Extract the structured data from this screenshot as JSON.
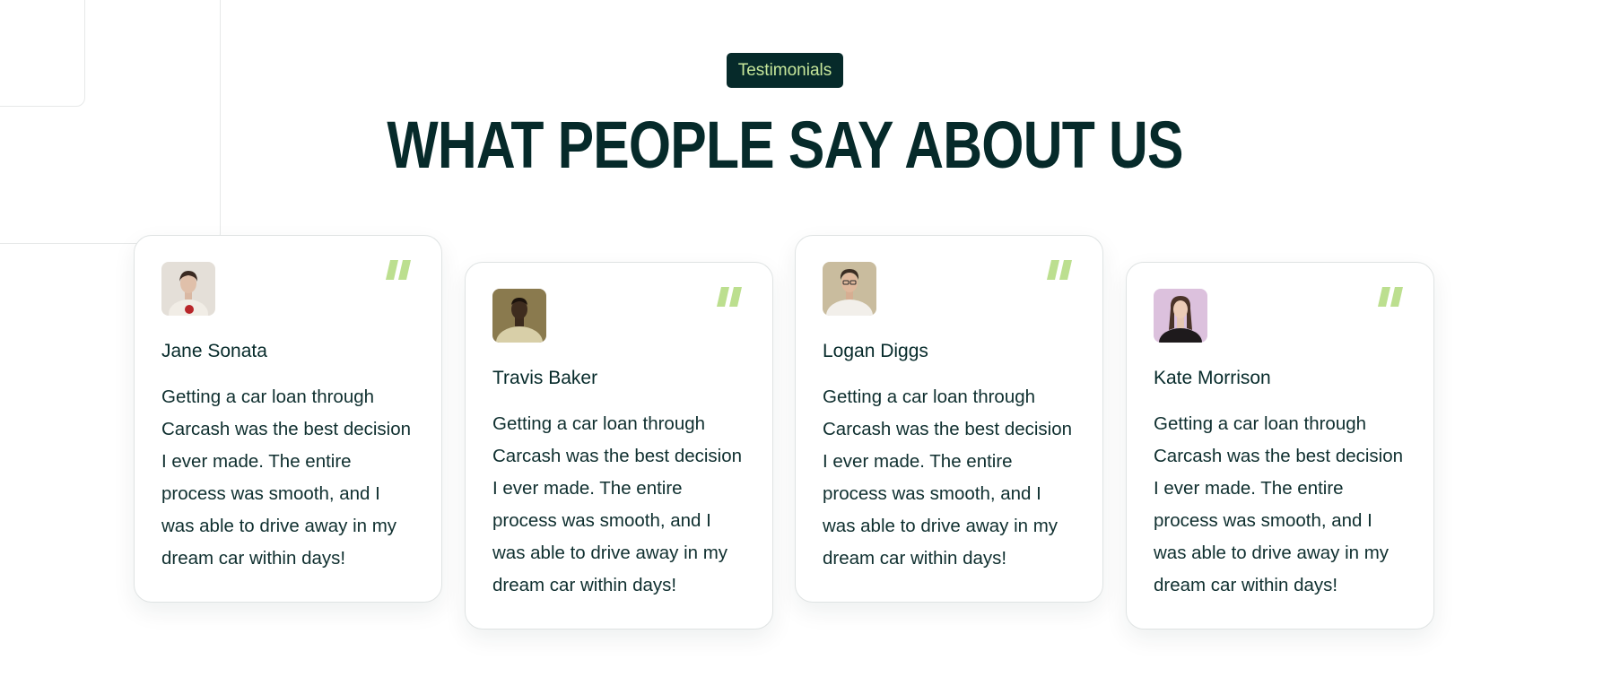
{
  "section": {
    "badge": "Testimonials",
    "title": "WHAT PEOPLE SAY ABOUT US"
  },
  "testimonials": [
    {
      "name": "Jane Sonata",
      "quote": "Getting a car loan through Carcash was the best decision I ever made. The entire process was smooth, and I was able to drive away in my dream car within days!",
      "avatar_icon": "woman-portrait-photo"
    },
    {
      "name": "Travis Baker",
      "quote": "Getting a car loan through Carcash was the best decision I ever made. The entire process was smooth, and I was able to drive away in my dream car within days!",
      "avatar_icon": "man-portrait-photo"
    },
    {
      "name": "Logan Diggs",
      "quote": "Getting a car loan through Carcash was the best decision I ever made. The entire process was smooth, and I was able to drive away in my dream car within days!",
      "avatar_icon": "man-portrait-photo"
    },
    {
      "name": "Kate Morrison",
      "quote": "Getting a car loan through Carcash was the best decision I ever made. The entire process was smooth, and I was able to drive away in my dream car within days!",
      "avatar_icon": "woman-portrait-photo"
    }
  ],
  "colors": {
    "dark_green": "#062a2a",
    "accent_lime": "#c6e69a",
    "quote_mark": "#bcdf8f",
    "card_border": "#dfe3e3"
  }
}
